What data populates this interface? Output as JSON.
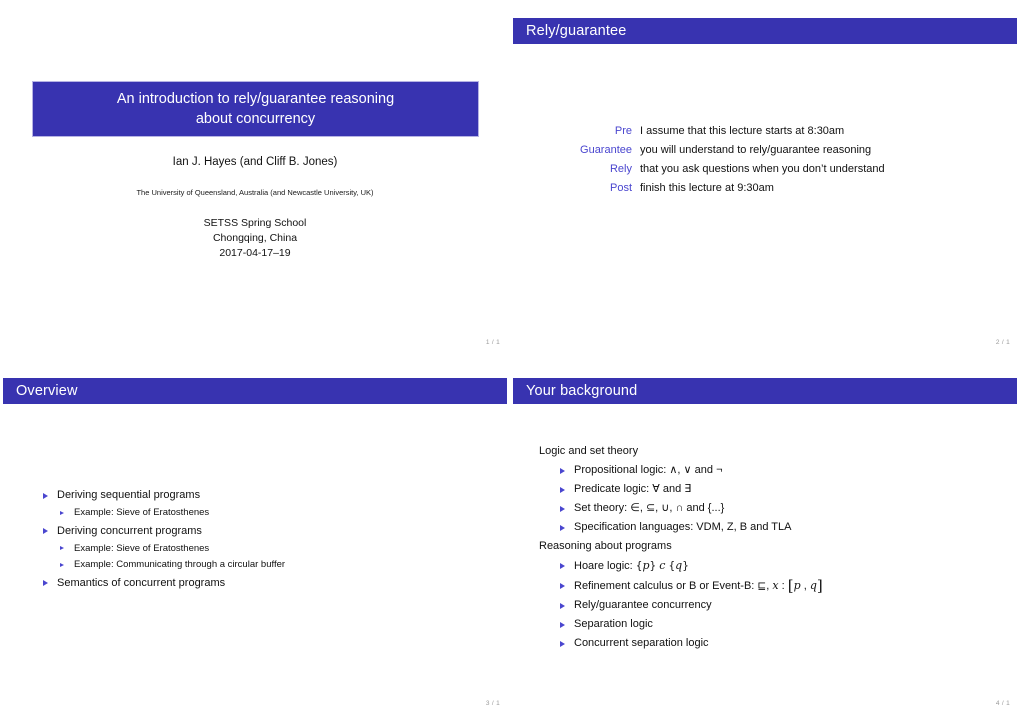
{
  "document": {
    "kind": "slide-handout-4up",
    "accent_color": "#3833b0",
    "bullet_color": "#4a46cf",
    "label_color": "#4a46cf",
    "page_number_color": "#9a9a9a"
  },
  "slides": [
    {
      "id": "title-slide",
      "frame_title": "",
      "title_line1": "An introduction to rely/guarantee reasoning",
      "title_line2": "about concurrency",
      "authors": "Ian J. Hayes (and Cliff B. Jones)",
      "institute": "The University of Queensland, Australia (and Newcastle University, UK)",
      "venue_line1": "SETSS Spring School",
      "venue_line2": "Chongqing, China",
      "venue_line3": "2017-04-17–19",
      "page_number": "1 / 1"
    },
    {
      "id": "rely-guarantee-slide",
      "frame_title": "Rely/guarantee",
      "rows": [
        {
          "key": "Pre",
          "value": "I assume that this lecture starts at 8:30am"
        },
        {
          "key": "Guarantee",
          "value": "you will understand to rely/guarantee reasoning"
        },
        {
          "key": "Rely",
          "value": "that you ask questions when you don’t understand"
        },
        {
          "key": "Post",
          "value": "finish this lecture at 9:30am"
        }
      ],
      "page_number": "2 / 1"
    },
    {
      "id": "overview-slide",
      "frame_title": "Overview",
      "items": [
        {
          "label": "Deriving sequential programs",
          "children": [
            "Example: Sieve of Eratosthenes"
          ]
        },
        {
          "label": "Deriving concurrent programs",
          "children": [
            "Example: Sieve of Eratosthenes",
            "Example: Communicating through a circular buffer"
          ]
        },
        {
          "label": "Semantics of concurrent programs",
          "children": []
        }
      ],
      "page_number": "3 / 1"
    },
    {
      "id": "your-background-slide",
      "frame_title": "Your background",
      "groups": [
        {
          "heading": "Logic and set theory",
          "items": [
            {
              "text": "Propositional logic: ∧, ∨ and ¬"
            },
            {
              "text": "Predicate logic: ∀ and ∃"
            },
            {
              "text": "Set theory: ∈, ⊆, ∪, ∩ and {...}"
            },
            {
              "text": "Specification languages: VDM, Z, B and TLA"
            }
          ]
        },
        {
          "heading": "Reasoning about programs",
          "items": [
            {
              "text": "Hoare logic: {p} c {q}",
              "math": "hoare"
            },
            {
              "text": "Refinement calculus or B or Event-B: ⊑, x : [p , q]",
              "math": "refinement"
            },
            {
              "text": "Rely/guarantee concurrency"
            },
            {
              "text": "Separation logic"
            },
            {
              "text": "Concurrent separation logic"
            }
          ]
        }
      ],
      "math_pieces": {
        "hoare_prefix": "Hoare logic: ",
        "hoare_open": "{",
        "hoare_p": "p",
        "hoare_close": "}",
        "hoare_c": "c",
        "hoare_open2": "{",
        "hoare_q": "q",
        "hoare_close2": "}",
        "refine_prefix": "Refinement calculus or B or Event-B: ",
        "refine_sqsubseteq": "⊑",
        "refine_comma": ", ",
        "refine_x": "x",
        "refine_colon": " : ",
        "refine_lbrack": "[",
        "refine_p": "p",
        "refine_mid": " , ",
        "refine_q": "q",
        "refine_rbrack": "]"
      },
      "page_number": "4 / 1"
    }
  ]
}
